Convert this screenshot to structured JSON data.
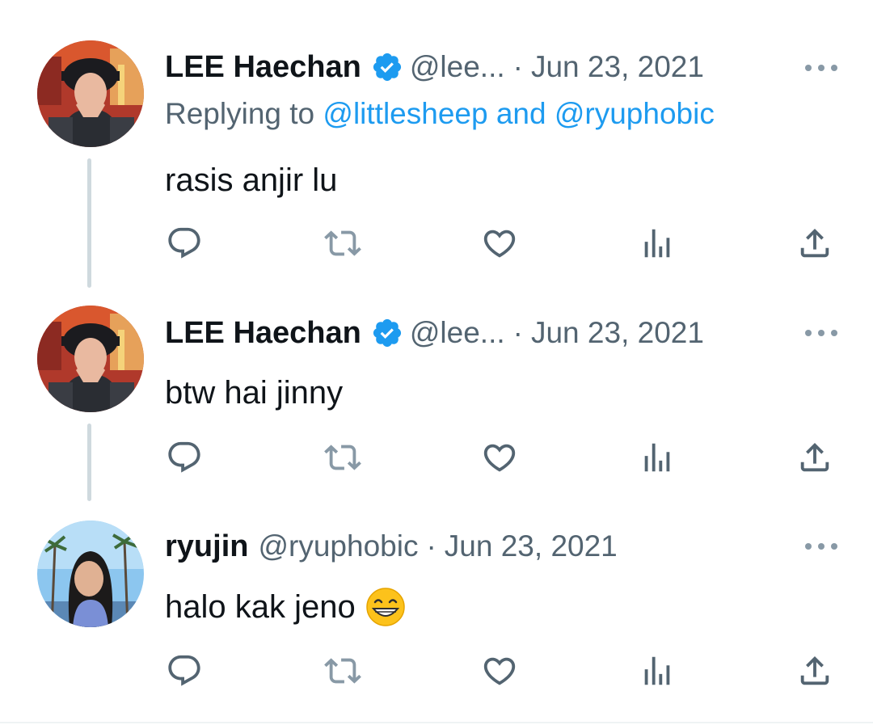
{
  "colors": {
    "text_primary": "#0f1419",
    "text_secondary": "#536471",
    "link": "#1d9bf0",
    "verified": "#1d9bf0",
    "thread_line": "#cfd9de",
    "icon": "#536471"
  },
  "tweets": [
    {
      "name": "LEE Haechan",
      "verified": true,
      "handle": "@lee...",
      "separator": "·",
      "date": "Jun 23, 2021",
      "replying_label": "Replying to",
      "replying_mentions": "@littlesheep and @ryuphobic",
      "text": "rasis anjir lu",
      "avatar": "avatar-lee-haechan"
    },
    {
      "name": "LEE Haechan",
      "verified": true,
      "handle": "@lee...",
      "separator": "·",
      "date": "Jun 23, 2021",
      "text": "btw hai jinny",
      "avatar": "avatar-lee-haechan"
    },
    {
      "name": "ryujin",
      "verified": false,
      "handle": "@ryuphobic",
      "separator": "·",
      "date": "Jun 23, 2021",
      "text": "halo kak jeno",
      "emoji": "grinning-face-with-smiling-eyes",
      "avatar": "avatar-ryujin"
    }
  ],
  "icons": {
    "more": "more-dots-icon",
    "reply": "reply-icon",
    "retweet": "retweet-icon",
    "like": "like-icon",
    "views": "views-icon",
    "share": "share-icon",
    "verified": "verified-badge-icon"
  }
}
